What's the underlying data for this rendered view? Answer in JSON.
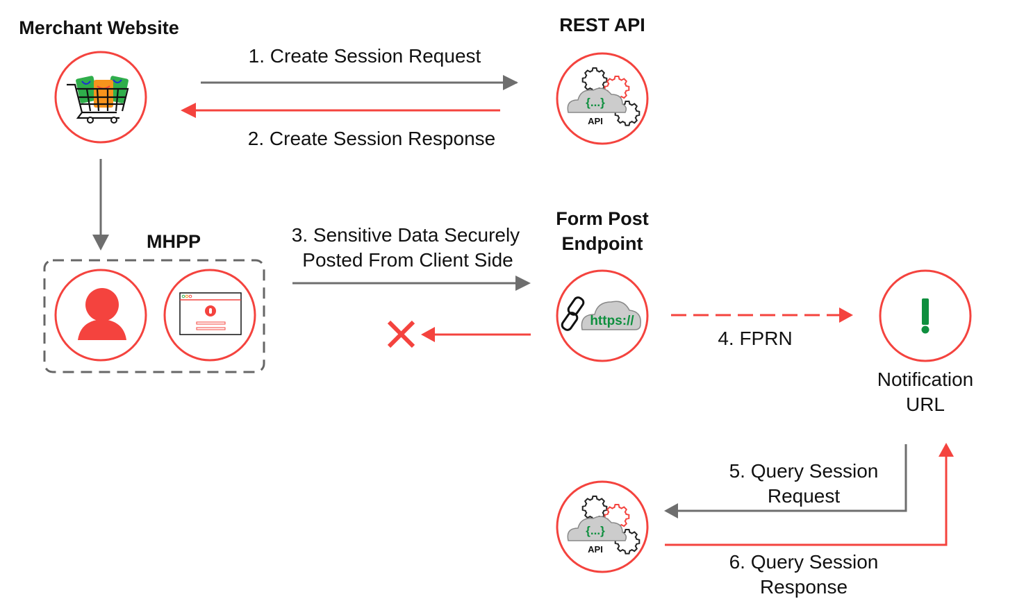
{
  "colors": {
    "accent_red": "#f4433e",
    "arrow_gray": "#6e6e6e",
    "dash_gray": "#666666",
    "green": "#0e8f3e",
    "cloud_gray": "#cccccc",
    "orange": "#f7941d",
    "cart_green": "#2fae4b",
    "blue": "#1e2bd6"
  },
  "nodes": {
    "merchant": {
      "title": "Merchant Website",
      "icon": "shopping-cart-icon"
    },
    "rest_api": {
      "title": "REST API",
      "icon": "api-cloud-gears-icon",
      "icon_text": "API",
      "icon_braces": "{...}"
    },
    "mhpp": {
      "title": "MHPP",
      "icons": [
        "user-icon",
        "login-window-icon"
      ]
    },
    "form_post": {
      "title_line1": "Form Post",
      "title_line2": "Endpoint",
      "icon": "link-cloud-https-icon",
      "icon_text": "https://"
    },
    "notification": {
      "title_line1": "Notification",
      "title_line2": "URL",
      "icon": "exclamation-icon",
      "icon_text": "!"
    },
    "query_api": {
      "icon": "api-cloud-gears-icon",
      "icon_text": "API",
      "icon_braces": "{...}"
    }
  },
  "flows": [
    {
      "step": 1,
      "label": "1. Create Session Request",
      "from": "merchant",
      "to": "rest_api",
      "style": "solid-gray"
    },
    {
      "step": 2,
      "label": "2. Create Session Response",
      "from": "rest_api",
      "to": "merchant",
      "style": "solid-red"
    },
    {
      "step": 3,
      "label_line1": "3. Sensitive Data Securely",
      "label_line2": "Posted From Client Side",
      "from": "mhpp",
      "to": "form_post",
      "style": "solid-gray"
    },
    {
      "step": "3b",
      "label": "",
      "from": "form_post",
      "to": "mhpp",
      "style": "solid-red",
      "blocked_marker": "x-icon"
    },
    {
      "step": 4,
      "label": "4. FPRN",
      "from": "form_post",
      "to": "notification",
      "style": "dashed-red"
    },
    {
      "step": 5,
      "label_line1": "5. Query Session",
      "label_line2": "Request",
      "from": "notification",
      "to": "query_api",
      "style": "solid-gray"
    },
    {
      "step": 6,
      "label_line1": "6. Query Session",
      "label_line2": "Response",
      "from": "query_api",
      "to": "notification",
      "style": "solid-red"
    },
    {
      "step": "0",
      "label": "",
      "from": "merchant",
      "to": "mhpp",
      "style": "solid-gray"
    }
  ]
}
